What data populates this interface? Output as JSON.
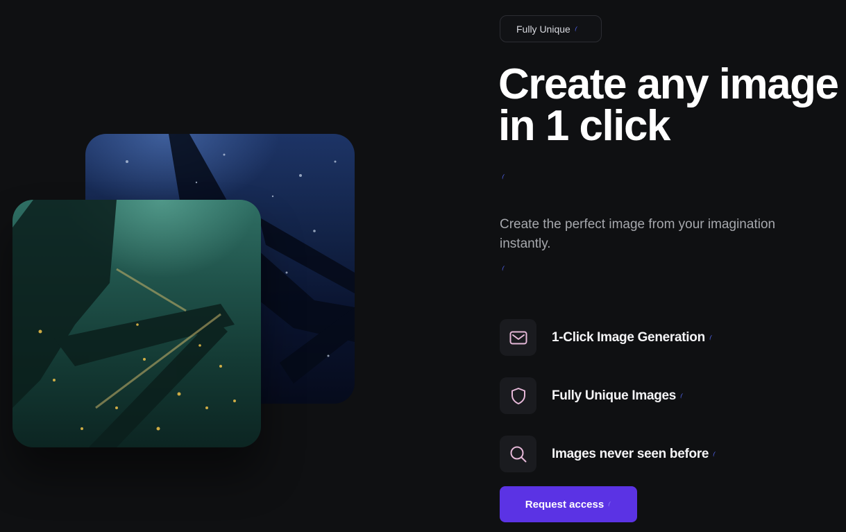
{
  "badge": {
    "label": "Fully Unique"
  },
  "hero": {
    "headline_line1": "Create any image",
    "headline_line2": "in 1 click",
    "subtitle": "Create the perfect image from your imagination instantly."
  },
  "features": [
    {
      "label": "1-Click Image Generation",
      "icon": "mail-icon"
    },
    {
      "label": "Fully Unique Images",
      "icon": "shield-icon"
    },
    {
      "label": "Images never seen before",
      "icon": "search-icon"
    }
  ],
  "cta": {
    "label": "Request access"
  },
  "colors": {
    "background": "#0f1012",
    "accent": "#5b33e4",
    "icon_stroke": "#e6b8d8",
    "subtitle_text": "#a6a8ad"
  }
}
